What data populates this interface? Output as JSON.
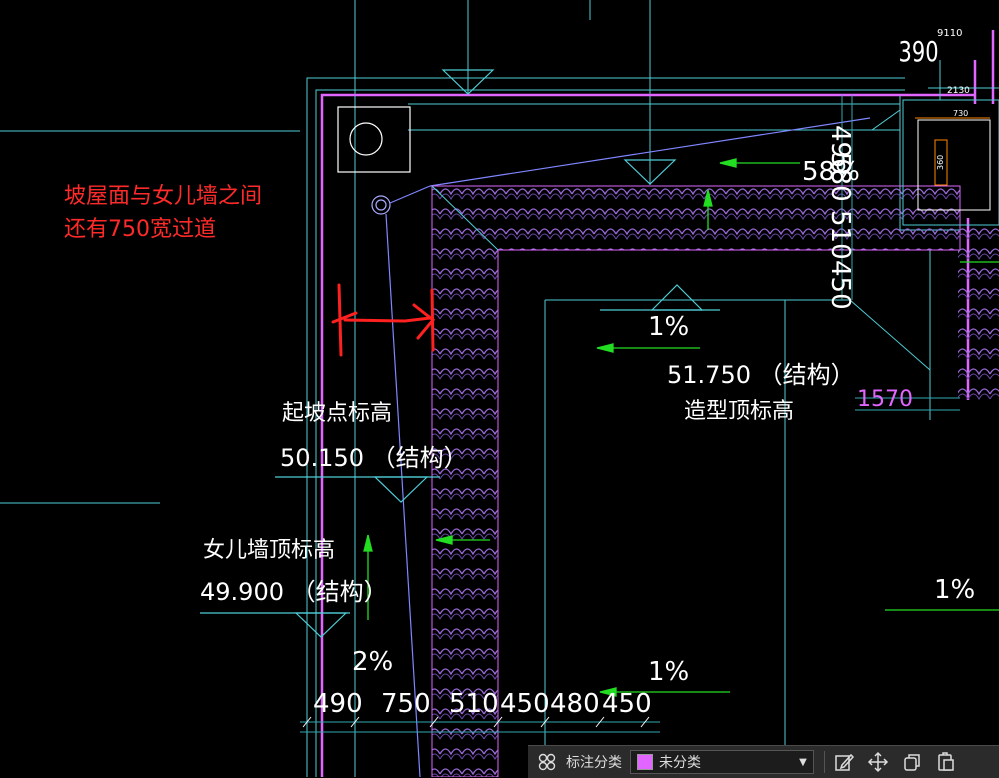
{
  "drawing": {
    "colors": {
      "background": "#000000",
      "wall": "#e066ff",
      "grid": "#4ecdd6",
      "dim_line": "#2fa8b0",
      "slope_arrow": "#22dd22",
      "tile_hatch": "#9a6ad6",
      "text": "#ffffff",
      "annotation": "#ff2a2a"
    },
    "annotation": {
      "line1": "坡屋面与女儿墙之间",
      "line2": "还有750宽过道"
    },
    "labels": {
      "start_slope_title": "起坡点标高",
      "start_slope_value": "50.150 （结构）",
      "parapet_title": "女儿墙顶标高",
      "parapet_value": "49.900 （结构）",
      "ridge_value": "51.750 （结构）",
      "ridge_title": "造型顶标高"
    },
    "slopes": {
      "top_right": "58%",
      "center": "1%",
      "right": "1%",
      "bottom_left": "2%",
      "bottom_center": "1%"
    },
    "dimensions_bottom": [
      "490",
      "750",
      "510",
      "450",
      "480",
      "450"
    ],
    "dimensions_right_vertical": [
      "490",
      "580",
      "510",
      "450"
    ],
    "dimensions_top_right": {
      "d390": "390",
      "d1570": "1570",
      "d110": "9110",
      "d130": "2130",
      "d730": "730",
      "d360": "360"
    }
  },
  "toolbar": {
    "grid_icon": "grid-icon",
    "category_label": "标注分类",
    "select_value": "未分类",
    "select_swatch_color": "#e066ff",
    "buttons": [
      "edit-icon",
      "move-icon",
      "copy-icon",
      "paste-icon"
    ]
  }
}
